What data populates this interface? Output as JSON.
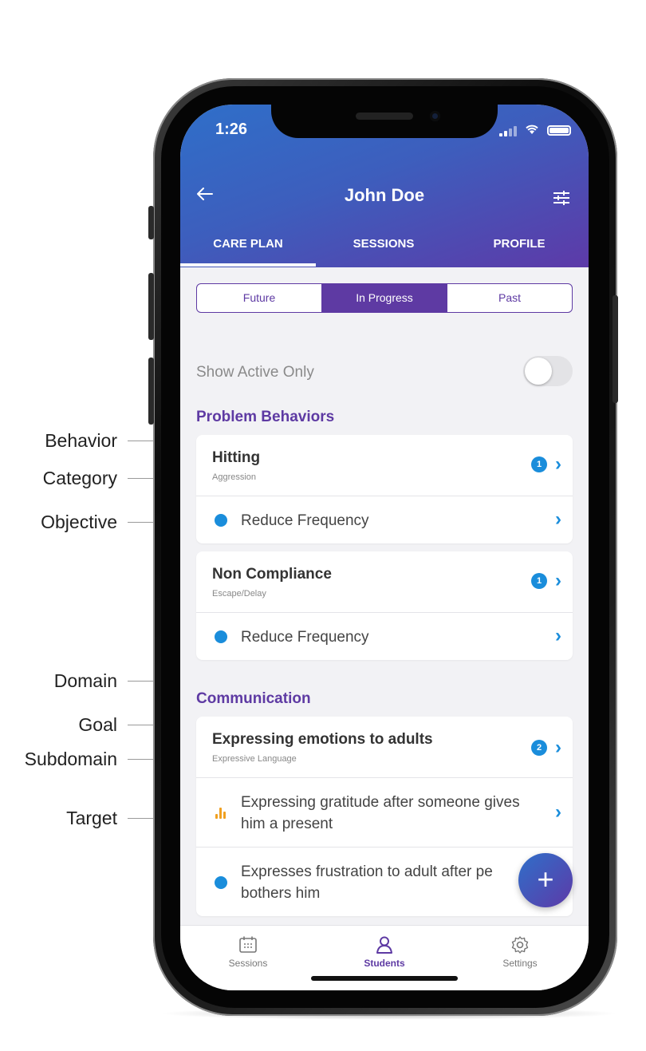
{
  "annotations": [
    {
      "label": "Behavior"
    },
    {
      "label": "Category"
    },
    {
      "label": "Objective"
    },
    {
      "label": "Domain"
    },
    {
      "label": "Goal"
    },
    {
      "label": "Subdomain"
    },
    {
      "label": "Target"
    }
  ],
  "status_bar": {
    "time": "1:26"
  },
  "header": {
    "title": "John Doe",
    "back_icon": "arrow-left-icon",
    "filter_icon": "sliders-icon"
  },
  "tabs": [
    {
      "label": "CARE PLAN",
      "active": true
    },
    {
      "label": "SESSIONS",
      "active": false
    },
    {
      "label": "PROFILE",
      "active": false
    }
  ],
  "segments": [
    {
      "label": "Future",
      "selected": false
    },
    {
      "label": "In Progress",
      "selected": true
    },
    {
      "label": "Past",
      "selected": false
    }
  ],
  "show_active": {
    "label": "Show Active Only",
    "enabled": false
  },
  "sections": {
    "problem_behaviors": "Problem Behaviors",
    "communication": "Communication"
  },
  "behaviors": [
    {
      "title": "Hitting",
      "subtitle": "Aggression",
      "badge": "1",
      "objective": "Reduce Frequency"
    },
    {
      "title": "Non Compliance",
      "subtitle": "Escape/Delay",
      "badge": "1",
      "objective": "Reduce Frequency"
    }
  ],
  "goal": {
    "title": "Expressing emotions to adults",
    "subtitle": "Expressive Language",
    "badge": "2",
    "targets": [
      {
        "line1": "Expressing gratitude after someone gives",
        "line2": "him a present",
        "icon": "bar-chart-icon"
      },
      {
        "line1": "Expresses frustration to adult after pe",
        "line2": "bothers him",
        "icon": "dot-icon"
      }
    ]
  },
  "fab": {
    "label": "+"
  },
  "bottom_nav": [
    {
      "label": "Sessions",
      "icon": "calendar-icon",
      "active": false
    },
    {
      "label": "Students",
      "icon": "person-icon",
      "active": true
    },
    {
      "label": "Settings",
      "icon": "gear-icon",
      "active": false
    }
  ],
  "colors": {
    "accent": "#5e3aa3",
    "blue": "#1a8ddb",
    "target_bars": "#f0a020"
  }
}
